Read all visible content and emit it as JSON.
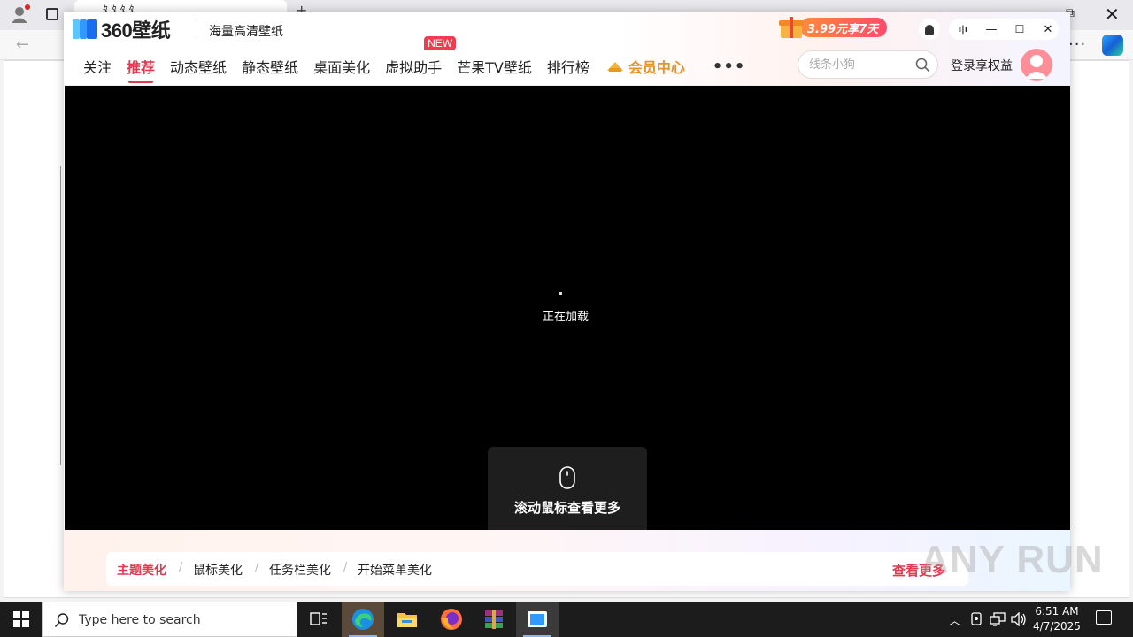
{
  "browser": {
    "tab_title": "ﾀ ﾀ ﾀ ﾀ",
    "new_tab": "+",
    "close": "✕",
    "restore": "⧉",
    "more": "···"
  },
  "app": {
    "logo_text": "360壁纸",
    "slogan": "海量高清壁纸",
    "promo_text": "3.99元享7天",
    "window_controls": {
      "widget": "ı|ı",
      "minimize": "—",
      "maximize": "☐",
      "close": "✕"
    },
    "nav": {
      "items": [
        {
          "label": "关注"
        },
        {
          "label": "推荐"
        },
        {
          "label": "动态壁纸"
        },
        {
          "label": "静态壁纸"
        },
        {
          "label": "桌面美化"
        },
        {
          "label": "虚拟助手"
        },
        {
          "label": "芒果TV壁纸"
        },
        {
          "label": "排行榜"
        }
      ],
      "new_badge": "NEW",
      "vip_label": "会员中心",
      "more": "•••"
    },
    "search": {
      "placeholder": "线条小狗"
    },
    "login_text": "登录享权益",
    "content": {
      "loading_text": "正在加载",
      "scroll_hint": "滚动鼠标查看更多"
    },
    "footer": {
      "links": [
        {
          "label": "主题美化"
        },
        {
          "label": "鼠标美化"
        },
        {
          "label": "任务栏美化"
        },
        {
          "label": "开始菜单美化"
        }
      ],
      "separator": "/",
      "more": "查看更多"
    },
    "colors": {
      "accent": "#e8364f",
      "vip": "#e7922a",
      "promo": "#ff5a5a"
    }
  },
  "watermark": "ANY RUN",
  "taskbar": {
    "search_placeholder": "Type here to search",
    "clock_time": "6:51 AM",
    "clock_date": "4/7/2025",
    "apps": [
      "task-view-icon",
      "edge-icon",
      "file-explorer-icon",
      "firefox-icon",
      "winrar-icon",
      "wallpaper-app-icon"
    ],
    "tray_icons": [
      "chevron-up-icon",
      "security-icon",
      "network-icon",
      "volume-icon"
    ]
  }
}
